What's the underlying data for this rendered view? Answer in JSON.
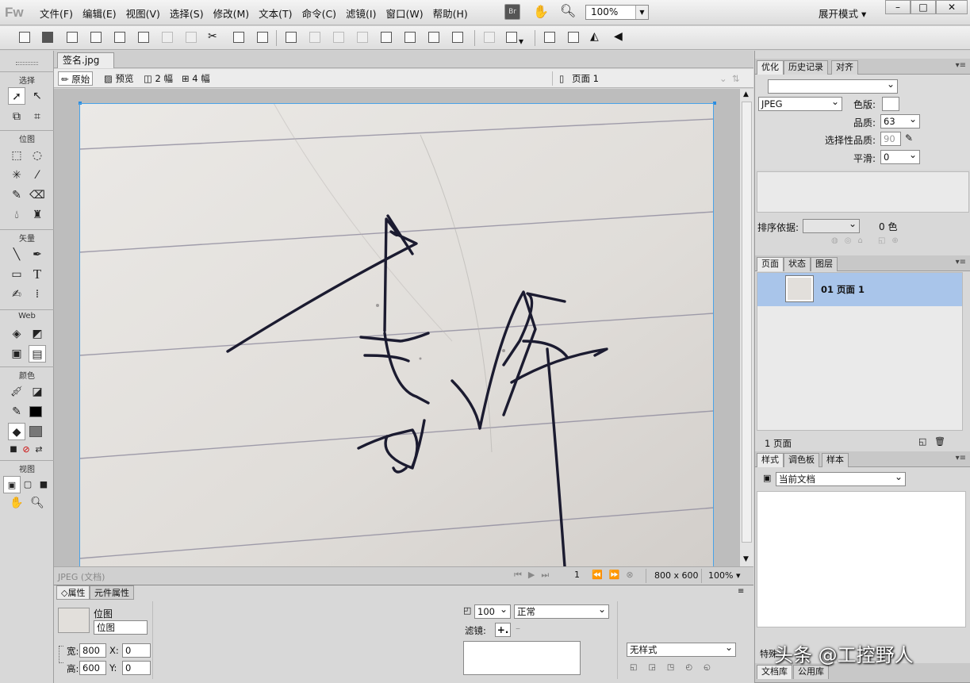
{
  "app": {
    "logo": "Fw",
    "mode_label": "展开模式",
    "zoom": "100%"
  },
  "menu": [
    "文件(F)",
    "编辑(E)",
    "视图(V)",
    "选择(S)",
    "修改(M)",
    "文本(T)",
    "命令(C)",
    "滤镜(I)",
    "窗口(W)",
    "帮助(H)"
  ],
  "tools": {
    "sections": [
      "选择",
      "位图",
      "矢量",
      "Web",
      "颜色",
      "视图"
    ]
  },
  "document": {
    "tab_title": "签名.jpg",
    "view_buttons": [
      "原始",
      "预览",
      "2 幅",
      "4 幅"
    ],
    "page_label": "页面 1",
    "status_left": "JPEG (文档)",
    "page_number": "1",
    "size": "800 x 600",
    "zoom": "100%"
  },
  "properties": {
    "tabs": [
      "属性",
      "元件属性"
    ],
    "type": "位图",
    "name": "位图",
    "width_label": "宽:",
    "width": "800",
    "height_label": "高:",
    "height": "600",
    "x_label": "X:",
    "x": "0",
    "y_label": "Y:",
    "y": "0",
    "opacity": "100",
    "blend": "正常",
    "filters_label": "滤镜:",
    "style": "无样式"
  },
  "optimize_panel": {
    "tabs": [
      "优化",
      "历史记录",
      "对齐"
    ],
    "format": "JPEG",
    "palette_label": "色版:",
    "quality_label": "品质:",
    "quality": "63",
    "selective_label": "选择性品质:",
    "selective": "90",
    "smooth_label": "平滑:",
    "smooth": "0",
    "sort_label": "排序依据:",
    "colors": "0 色"
  },
  "pages_panel": {
    "tabs": [
      "页面",
      "状态",
      "图层"
    ],
    "page_item": "01  页面 1",
    "footer": "1  页面"
  },
  "styles_panel": {
    "tabs": [
      "样式",
      "调色板",
      "样本"
    ],
    "source": "当前文档"
  },
  "bottom_tabs": [
    "文档库",
    "公用库"
  ],
  "bottom_partial": "特殊",
  "watermark": "头条 @工控野人"
}
